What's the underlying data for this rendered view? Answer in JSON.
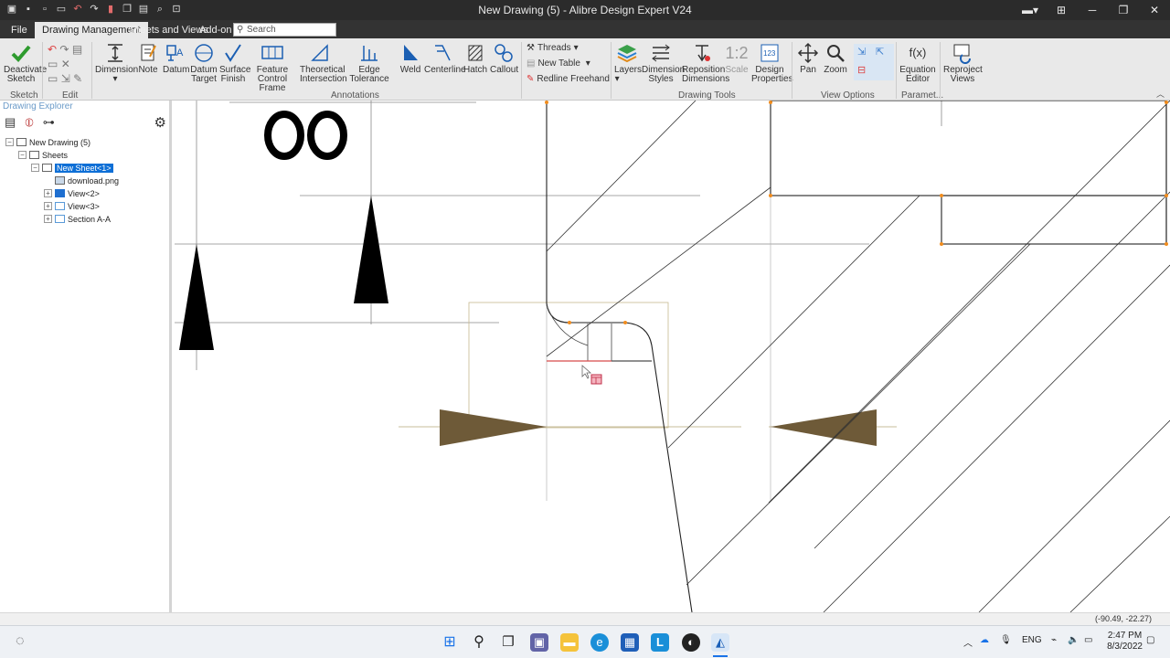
{
  "window": {
    "title": "New Drawing (5) - Alibre Design Expert V24",
    "controls": [
      "minimize",
      "restore",
      "close"
    ]
  },
  "menu_tabs": [
    {
      "label": "File",
      "active": false
    },
    {
      "label": "Drawing Management",
      "active": true
    },
    {
      "label": "Sheets and Views",
      "active": false
    },
    {
      "label": "Add-on",
      "active": false
    }
  ],
  "search": {
    "placeholder": "Search"
  },
  "ribbon": {
    "sketch": {
      "deactivate": "Deactivate Sketch"
    },
    "annotations": [
      {
        "label": "Dimension"
      },
      {
        "label": "Note"
      },
      {
        "label": "Datum"
      },
      {
        "label": "Datum Target"
      },
      {
        "label": "Surface Finish"
      },
      {
        "label": "Feature Control Frame"
      },
      {
        "label": "Theoretical Intersection"
      },
      {
        "label": "Edge Tolerance"
      },
      {
        "label": "Weld"
      },
      {
        "label": "Centerline"
      },
      {
        "label": "Hatch"
      },
      {
        "label": "Callout"
      }
    ],
    "small_buttons": [
      {
        "label": "Threads"
      },
      {
        "label": "New Table"
      },
      {
        "label": "Redline Freehand"
      }
    ],
    "drawing_tools": [
      {
        "label": "Layers"
      },
      {
        "label": "Dimension Styles"
      },
      {
        "label": "Reposition Dimensions"
      },
      {
        "label": "Scale",
        "value": "1:2"
      },
      {
        "label": "Design Properties"
      }
    ],
    "view_options": [
      {
        "label": "Pan"
      },
      {
        "label": "Zoom"
      }
    ],
    "param": [
      {
        "label": "Equation Editor",
        "icon_text": "f(x)"
      }
    ],
    "extra": [
      {
        "label": "Reproject Views"
      }
    ],
    "groups": {
      "sketch": "Sketch",
      "edit": "Edit",
      "annotations": "Annotations",
      "drawing_tools": "Drawing Tools",
      "view_options": "View Options",
      "param": "Paramet..."
    }
  },
  "explorer": {
    "title": "Drawing Explorer",
    "tree": [
      {
        "label": "New Drawing (5)",
        "level": 0,
        "toggle": "-"
      },
      {
        "label": "Sheets",
        "level": 1,
        "toggle": "-"
      },
      {
        "label": "New Sheet<1>",
        "level": 2,
        "toggle": "-",
        "selected": true
      },
      {
        "label": "download.png",
        "level": 3,
        "toggle": ""
      },
      {
        "label": "View<2>",
        "level": 3,
        "toggle": "+"
      },
      {
        "label": "View<3>",
        "level": 3,
        "toggle": "+"
      },
      {
        "label": "Section A-A",
        "level": 3,
        "toggle": "+"
      }
    ]
  },
  "status": {
    "coords": "(-90.49, -22.27)"
  },
  "taskbar": {
    "language": "ENG",
    "time": "2:47 PM",
    "date": "8/3/2022"
  },
  "colors": {
    "titlebar": "#2b2b2b",
    "ribbon": "#e9e9e9",
    "selection": "#0e6fd6",
    "section_arrow": "#6e5a38",
    "vertex": "#f08c1e"
  }
}
